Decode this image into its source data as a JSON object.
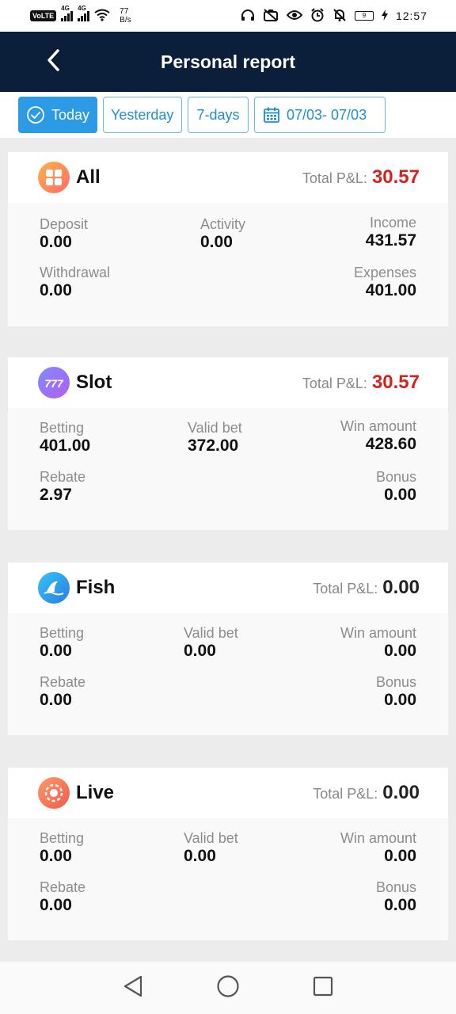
{
  "status_bar": {
    "volte": "VoLTE",
    "net1": "4G",
    "net2": "4G",
    "speed_value": "77",
    "speed_unit": "B/s",
    "battery": "9",
    "time": "12:57"
  },
  "header": {
    "title": "Personal report"
  },
  "filters": {
    "today": "Today",
    "yesterday": "Yesterday",
    "seven_days": "7-days",
    "date_range": "07/03- 07/03"
  },
  "cards": [
    {
      "name": "All",
      "pl_label": "Total P&L:",
      "pl_value": "30.57",
      "fields": {
        "deposit_label": "Deposit",
        "deposit_value": "0.00",
        "activity_label": "Activity",
        "activity_value": "0.00",
        "income_label": "Income",
        "income_value": "431.57",
        "withdrawal_label": "Withdrawal",
        "withdrawal_value": "0.00",
        "expenses_label": "Expenses",
        "expenses_value": "401.00"
      }
    },
    {
      "name": "Slot",
      "pl_label": "Total P&L:",
      "pl_value": "30.57",
      "fields": {
        "betting_label": "Betting",
        "betting_value": "401.00",
        "valid_bet_label": "Valid bet",
        "valid_bet_value": "372.00",
        "win_amount_label": "Win amount",
        "win_amount_value": "428.60",
        "rebate_label": "Rebate",
        "rebate_value": "2.97",
        "bonus_label": "Bonus",
        "bonus_value": "0.00"
      }
    },
    {
      "name": "Fish",
      "pl_label": "Total P&L:",
      "pl_value": "0.00",
      "fields": {
        "betting_label": "Betting",
        "betting_value": "0.00",
        "valid_bet_label": "Valid bet",
        "valid_bet_value": "0.00",
        "win_amount_label": "Win amount",
        "win_amount_value": "0.00",
        "rebate_label": "Rebate",
        "rebate_value": "0.00",
        "bonus_label": "Bonus",
        "bonus_value": "0.00"
      }
    },
    {
      "name": "Live",
      "pl_label": "Total P&L:",
      "pl_value": "0.00",
      "fields": {
        "betting_label": "Betting",
        "betting_value": "0.00",
        "valid_bet_label": "Valid bet",
        "valid_bet_value": "0.00",
        "win_amount_label": "Win amount",
        "win_amount_value": "0.00",
        "rebate_label": "Rebate",
        "rebate_value": "0.00",
        "bonus_label": "Bonus",
        "bonus_value": "0.00"
      }
    }
  ],
  "colors": {
    "header_bg": "#0b1f3a",
    "accent_blue": "#2d9ae6",
    "profit_red": "#d8211f"
  },
  "icons": {
    "back": "chevron-left-icon",
    "today": "check-circle-icon",
    "date": "calendar-icon",
    "all": "grid-icon",
    "slot": "slot-777-icon",
    "fish": "shark-fin-icon",
    "live": "poker-chip-icon",
    "nav_back": "triangle-back-icon",
    "nav_home": "circle-home-icon",
    "nav_recent": "square-recent-icon"
  }
}
